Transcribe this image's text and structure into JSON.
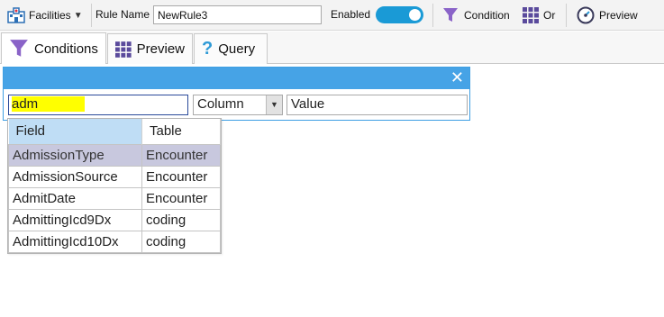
{
  "toolbar": {
    "facilities_label": "Facilities",
    "rule_name_label": "Rule Name",
    "rule_name_value": "NewRule3",
    "enabled_label": "Enabled",
    "enabled": true,
    "condition_label": "Condition",
    "or_label": "Or",
    "preview_label": "Preview"
  },
  "tabs": [
    {
      "label": "Conditions",
      "icon": "filter-icon",
      "active": true
    },
    {
      "label": "Preview",
      "icon": "grid-icon",
      "active": false
    },
    {
      "label": "Query",
      "icon": "question-icon",
      "active": false
    }
  ],
  "condition": {
    "field_value": "adm",
    "column_select": "Column",
    "value_input": "Value",
    "close_symbol": "✕"
  },
  "dropdown": {
    "headers": {
      "field": "Field",
      "table": "Table"
    },
    "rows": [
      {
        "field": "AdmissionType",
        "table": "Encounter",
        "selected": true
      },
      {
        "field": "AdmissionSource",
        "table": "Encounter",
        "selected": false
      },
      {
        "field": "AdmitDate",
        "table": "Encounter",
        "selected": false
      },
      {
        "field": "AdmittingIcd9Dx",
        "table": "coding",
        "selected": false
      },
      {
        "field": "AdmittingIcd10Dx",
        "table": "coding",
        "selected": false
      }
    ]
  },
  "colors": {
    "accent": "#46a3e6",
    "toggle": "#1a9ad6",
    "highlight": "#ffff00",
    "selected_row": "#c8c8de",
    "header_field": "#bfddf5"
  }
}
